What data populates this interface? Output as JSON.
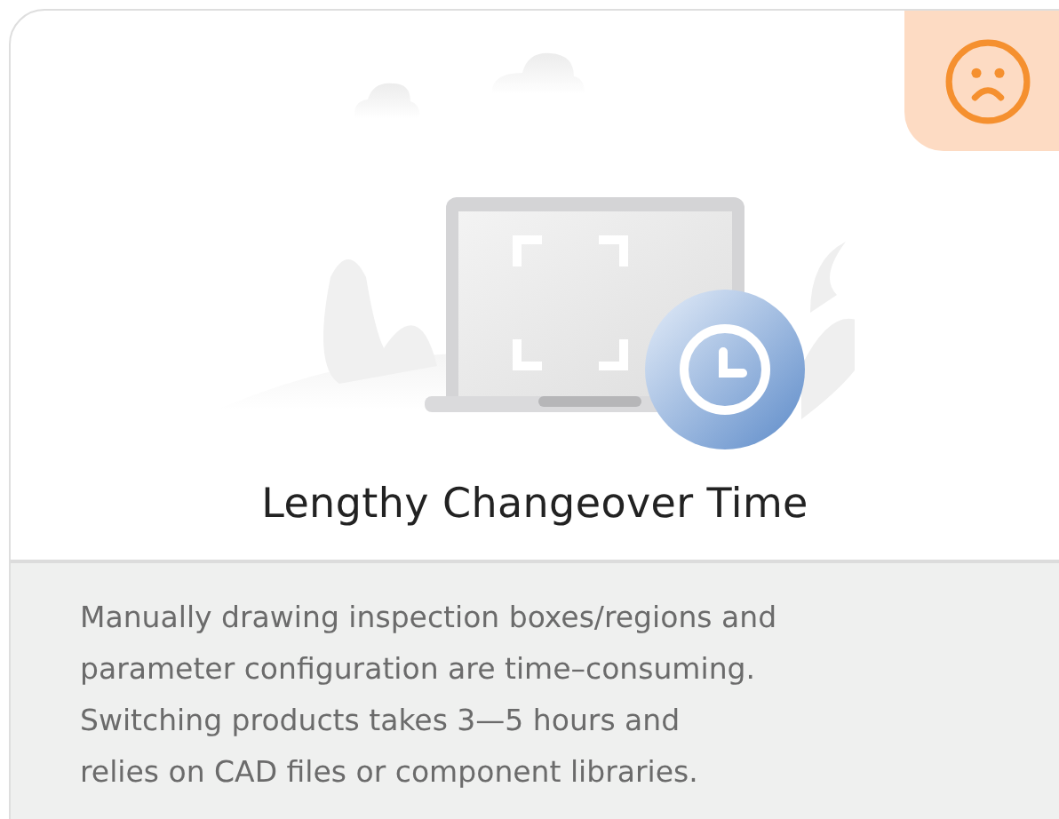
{
  "card": {
    "frowning": true,
    "title": "Lengthy Changeover Time",
    "description": "Manually drawing inspection boxes/regions and\nparameter configuration are time–consuming.\nSwitching products takes 3—5 hours and\nrelies on CAD files or component libraries."
  }
}
